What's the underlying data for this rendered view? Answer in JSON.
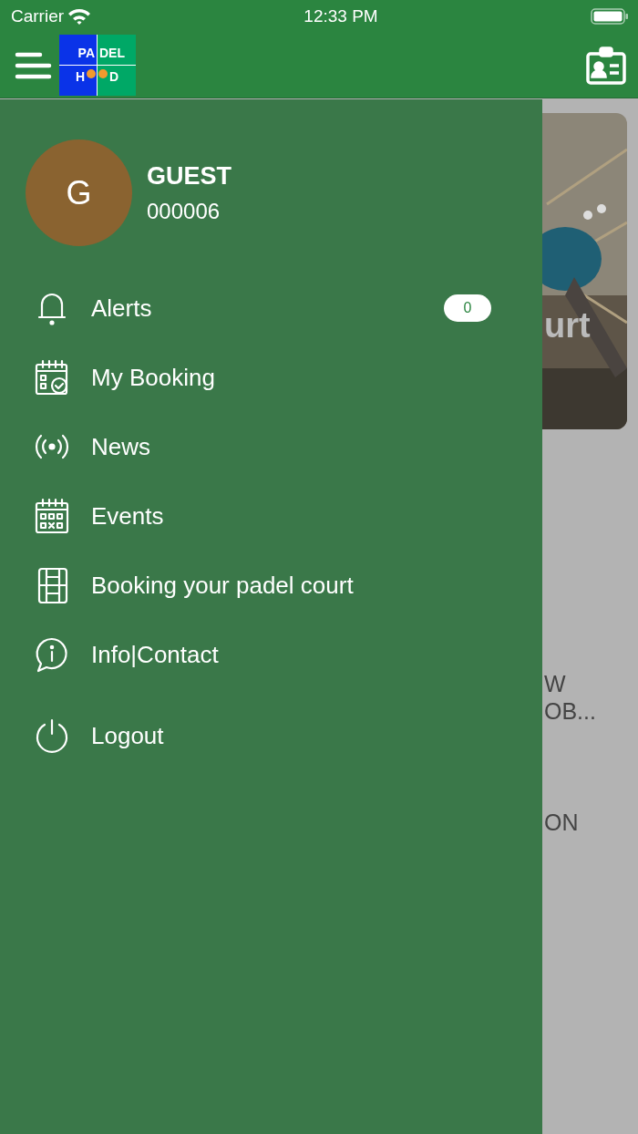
{
  "status_bar": {
    "carrier": "Carrier",
    "time": "12:33 PM"
  },
  "app_bar": {
    "logo": {
      "top_left": "PA",
      "top_right": "DEL",
      "bottom_left": "H",
      "bottom_right": "D"
    }
  },
  "profile": {
    "initial": "G",
    "name": "GUEST",
    "number": "000006"
  },
  "menu": [
    {
      "kind": "bell",
      "label": "Alerts",
      "badge": "0"
    },
    {
      "kind": "calendar-check",
      "label": "My Booking"
    },
    {
      "kind": "broadcast",
      "label": "News"
    },
    {
      "kind": "calendar-grid",
      "label": "Events"
    },
    {
      "kind": "court",
      "label": "Booking your padel court"
    },
    {
      "kind": "info",
      "label": "Info|Contact"
    },
    {
      "kind": "power",
      "label": "Logout"
    }
  ],
  "background": {
    "card_text": "urt",
    "texts": [
      "W",
      "OB...",
      "ON"
    ]
  }
}
